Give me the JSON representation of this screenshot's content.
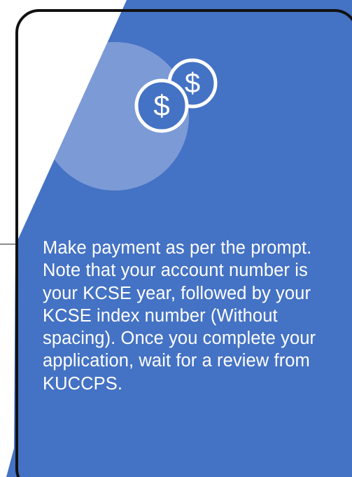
{
  "slide": {
    "message": "Make payment as per the prompt. Note that your account number is your KCSE year, followed by your KCSE index number (Without spacing). Once you complete your application, wait for a review from KUCCPS."
  },
  "icon": {
    "name": "coins-dollar-icon",
    "glyph": "$"
  },
  "colors": {
    "panel_blue": "#4472c4",
    "highlight_circle": "#7c9ad6",
    "border": "#111111",
    "text": "#ffffff"
  }
}
